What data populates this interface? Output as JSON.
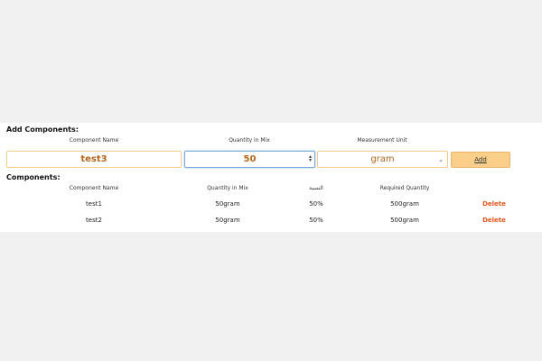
{
  "add_section": {
    "title": "Add Components:",
    "columns": {
      "name": "Component Name",
      "quantity": "Quantity in Mix",
      "unit": "Measurement Unit"
    },
    "inputs": {
      "name_value": "test3",
      "quantity_value": "50",
      "unit_selected": "gram"
    },
    "add_label": "Add"
  },
  "list_section": {
    "title": "Components:",
    "headers": {
      "name": "Component Name",
      "quantity": "Quantity in Mix",
      "ratio": "النسبة",
      "required": "Required Quantity"
    },
    "rows": [
      {
        "name": "test1",
        "quantity": "50gram",
        "ratio": "50%",
        "required": "500gram",
        "action": "Delete"
      },
      {
        "name": "test2",
        "quantity": "50gram",
        "ratio": "50%",
        "required": "500gram",
        "action": "Delete"
      }
    ]
  },
  "colors": {
    "accent": "#f9cf8a",
    "delete": "#e8541e",
    "input_text": "#b5651d"
  }
}
